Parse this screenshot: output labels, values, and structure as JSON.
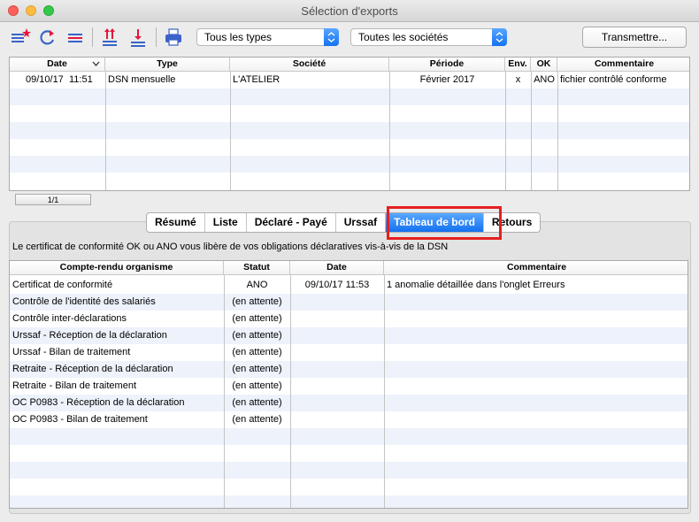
{
  "window": {
    "title": "Sélection d'exports"
  },
  "toolbar": {
    "type_filter": "Tous les types",
    "company_filter": "Toutes les sociétés",
    "transmit_label": "Transmettre..."
  },
  "exports": {
    "headers": [
      "Date",
      "Type",
      "Société",
      "Période",
      "Env.",
      "OK",
      "Commentaire"
    ],
    "rows": [
      {
        "date": "09/10/17",
        "time": "11:51",
        "type": "DSN mensuelle",
        "company": "L'ATELIER",
        "period": "Février 2017",
        "env": "x",
        "ok": "ANO",
        "comment": "fichier contrôlé conforme"
      }
    ],
    "pager": "1/1"
  },
  "tabs": {
    "items": [
      "Résumé",
      "Liste",
      "Déclaré - Payé",
      "Urssaf",
      "Tableau de bord",
      "Retours"
    ],
    "active": "Tableau de bord"
  },
  "dashboard": {
    "info": "Le certificat de conformité OK ou ANO vous libère de vos obligations déclaratives vis-à-vis de la DSN",
    "headers": [
      "Compte-rendu organisme",
      "Statut",
      "Date",
      "Commentaire"
    ],
    "rows": [
      {
        "name": "Certificat de conformité",
        "status": "ANO",
        "date": "09/10/17  11:53",
        "comment": "1 anomalie détaillée dans l'onglet Erreurs"
      },
      {
        "name": "Contrôle de l'identité des salariés",
        "status": "(en attente)",
        "date": "",
        "comment": ""
      },
      {
        "name": "Contrôle inter-déclarations",
        "status": "(en attente)",
        "date": "",
        "comment": ""
      },
      {
        "name": "Urssaf - Réception de la déclaration",
        "status": "(en attente)",
        "date": "",
        "comment": ""
      },
      {
        "name": "Urssaf - Bilan de traitement",
        "status": "(en attente)",
        "date": "",
        "comment": ""
      },
      {
        "name": "Retraite  - Réception de la déclaration",
        "status": "(en attente)",
        "date": "",
        "comment": ""
      },
      {
        "name": "Retraite  - Bilan de traitement",
        "status": "(en attente)",
        "date": "",
        "comment": ""
      },
      {
        "name": "OC P0983 - Réception de la déclaration",
        "status": "(en attente)",
        "date": "",
        "comment": ""
      },
      {
        "name": "OC P0983 - Bilan de traitement",
        "status": "(en attente)",
        "date": "",
        "comment": ""
      }
    ]
  },
  "colors": {
    "accent": "#1a74f0",
    "highlight": "#e61f1f",
    "row_alt": "#edf2fb"
  }
}
